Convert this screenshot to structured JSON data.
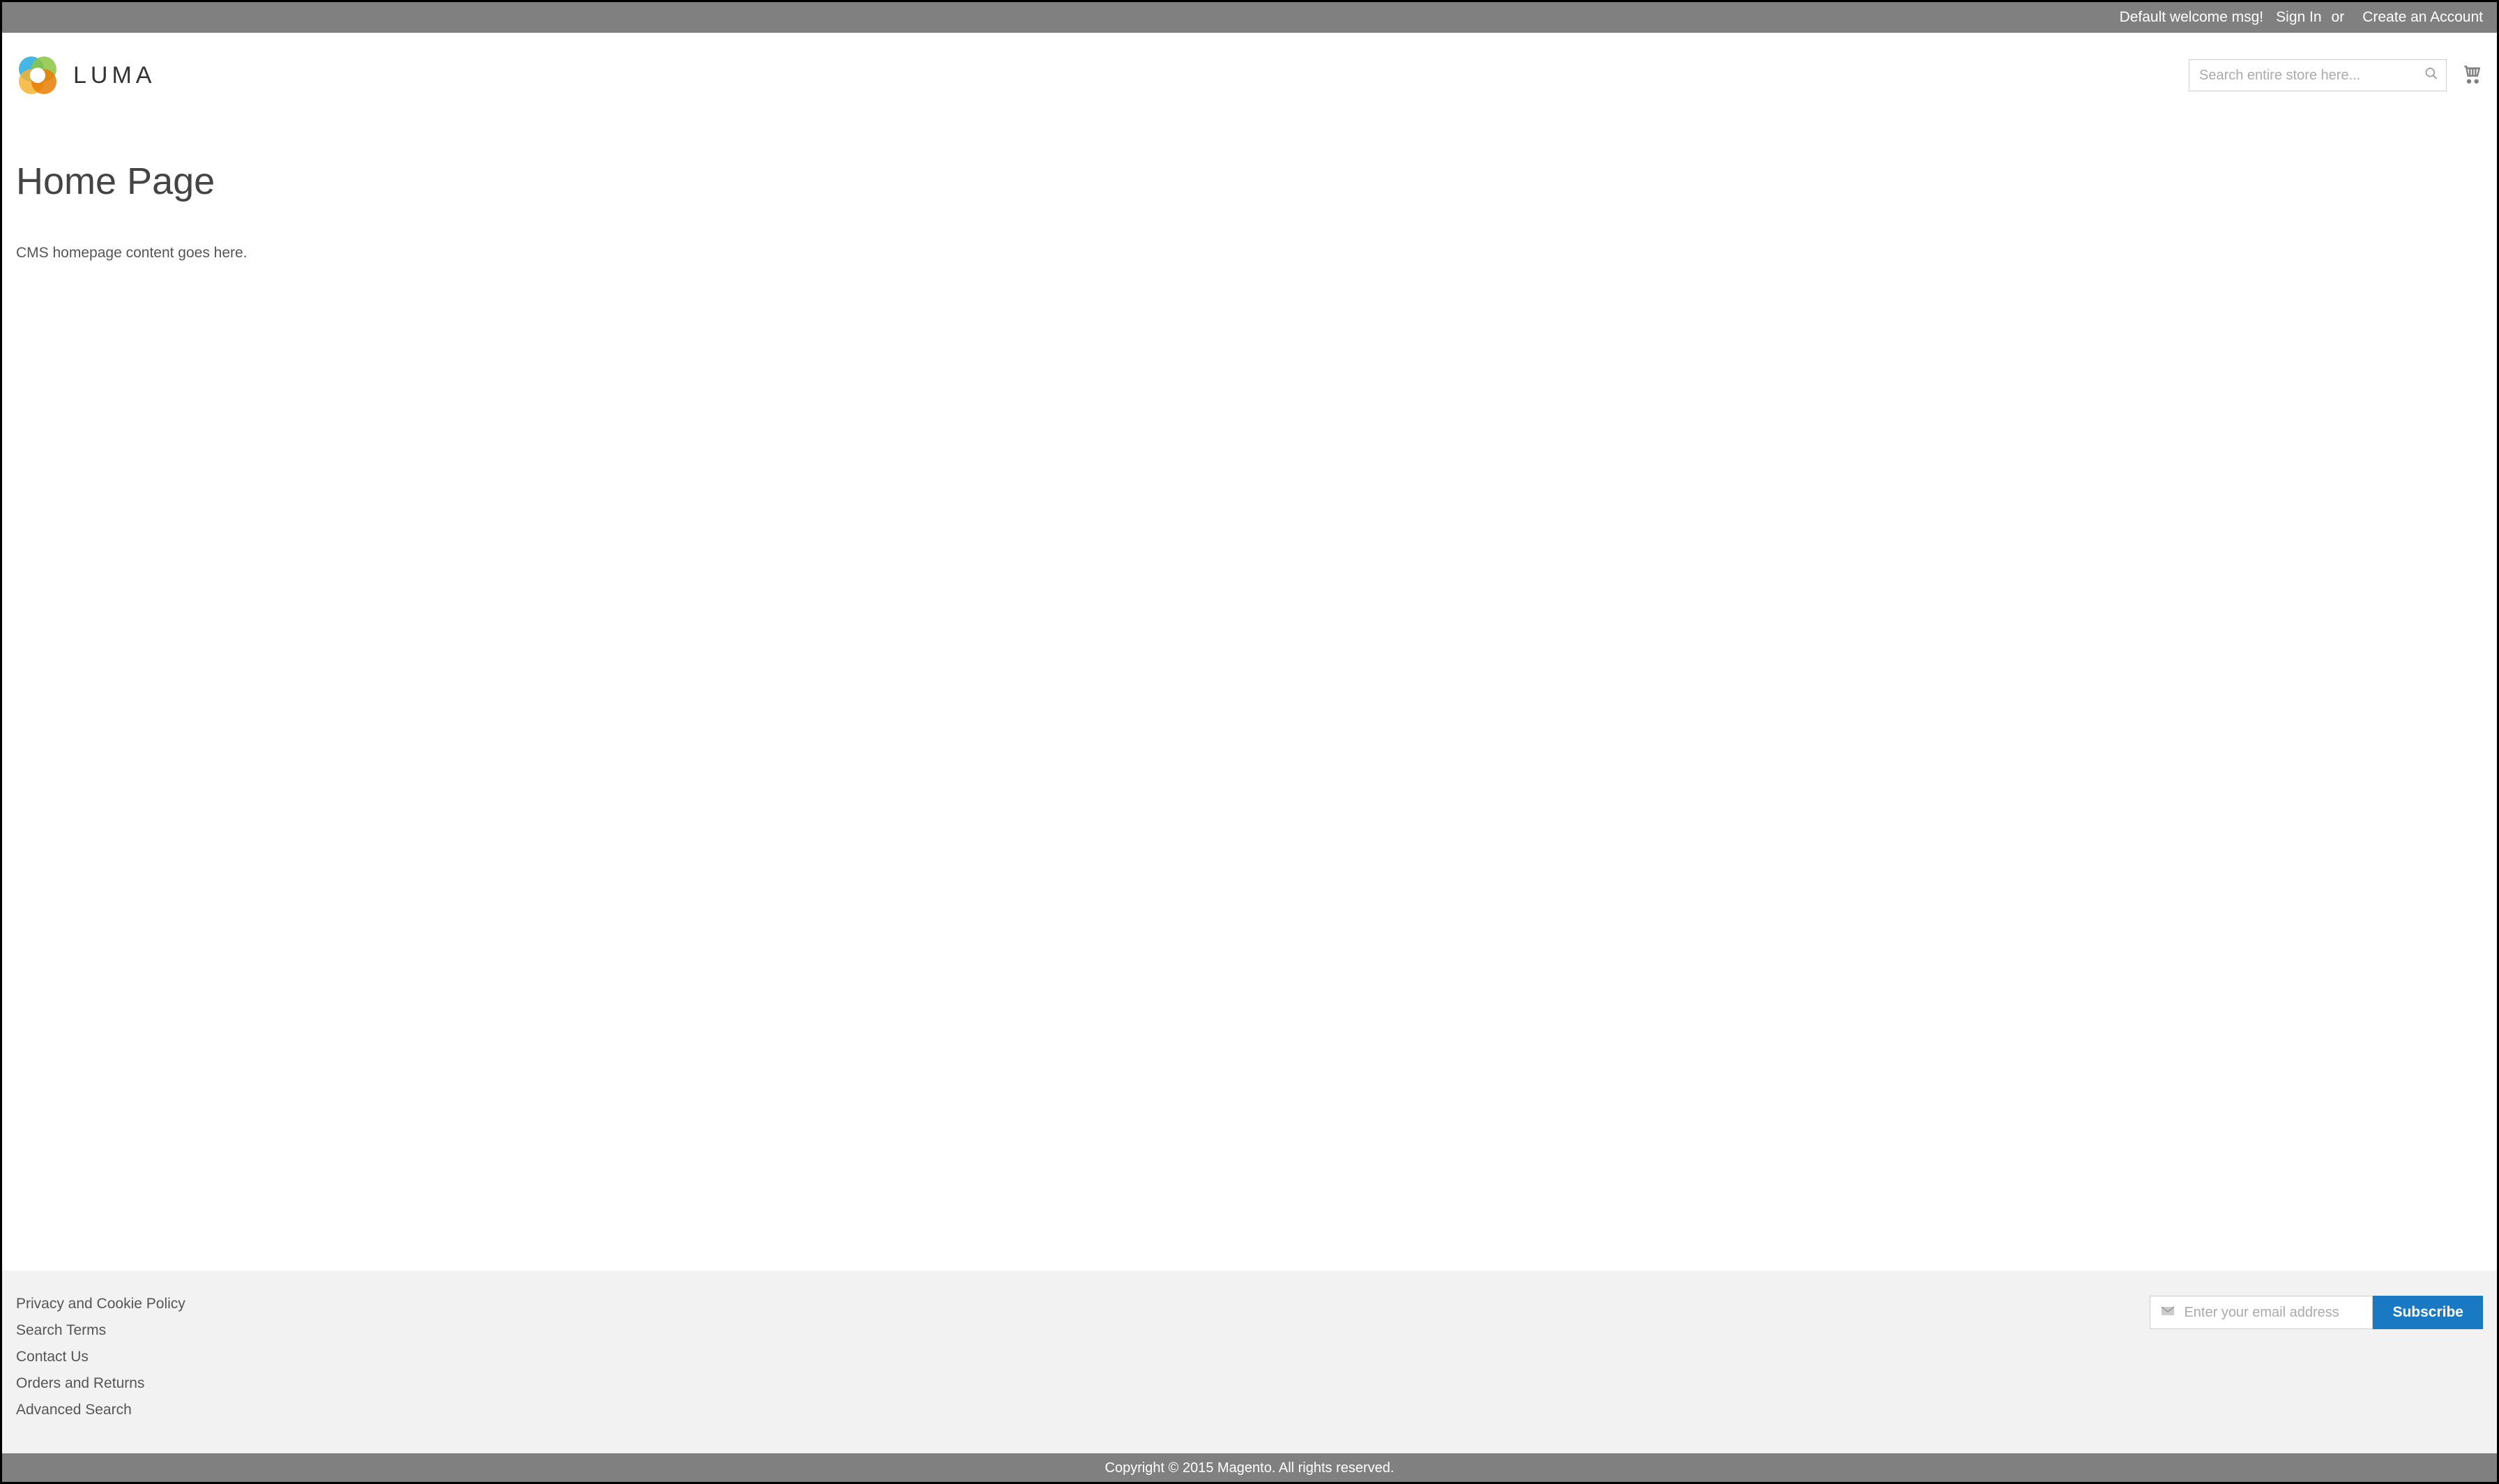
{
  "topbar": {
    "welcome": "Default welcome msg!",
    "signin": "Sign In",
    "or": "or",
    "create_account": "Create an Account"
  },
  "header": {
    "brand": "LUMA",
    "search_placeholder": "Search entire store here..."
  },
  "main": {
    "title": "Home Page",
    "content": "CMS homepage content goes here."
  },
  "footer": {
    "links": [
      "Privacy and Cookie Policy",
      "Search Terms",
      "Contact Us",
      "Orders and Returns",
      "Advanced Search"
    ],
    "newsletter_placeholder": "Enter your email address",
    "subscribe": "Subscribe"
  },
  "copyright": "Copyright © 2015 Magento. All rights reserved."
}
